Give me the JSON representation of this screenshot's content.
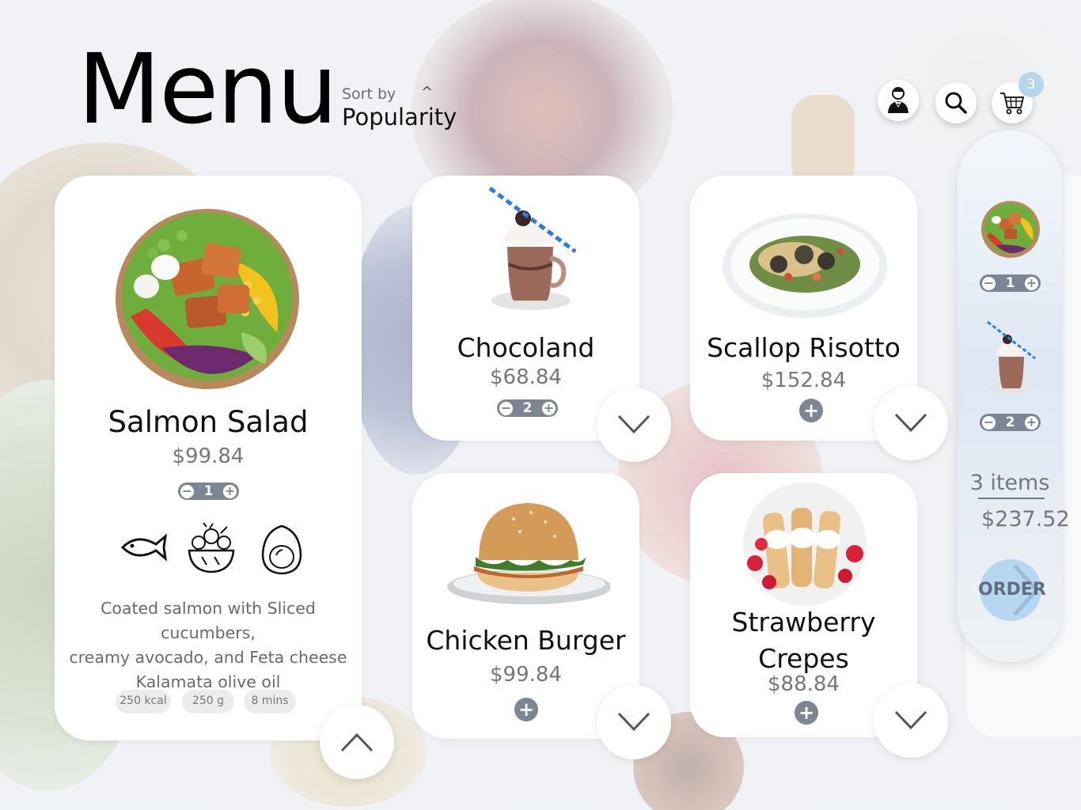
{
  "header": {
    "title": "Menu",
    "sort_label": "Sort by",
    "sort_value": "Popularity",
    "sort_caret": "^",
    "cart_count": "3"
  },
  "featured": {
    "name": "Salmon Salad",
    "price": "$99.84",
    "quantity": "1",
    "description_lines": [
      "Coated salmon with Sliced cucumbers,",
      "creamy avocado, and Feta cheese",
      "Kalamata olive oil"
    ],
    "chips": [
      "250 kcal",
      "250 g",
      "8 mins"
    ],
    "ingredient_icons": [
      "fish-icon",
      "vegetable-bowl-icon",
      "egg-icon"
    ]
  },
  "items": [
    {
      "name": "Chocoland",
      "price": "$68.84",
      "quantity": "2",
      "image": "milkshake"
    },
    {
      "name": "Scallop Risotto",
      "price": "$152.84",
      "image": "risotto-plate"
    },
    {
      "name": "Chicken Burger",
      "price": "$99.84",
      "image": "burger"
    },
    {
      "name_line1": "Strawberry",
      "name_line2": "Crepes",
      "price": "$88.84",
      "image": "crepes"
    }
  ],
  "order_panel": {
    "lines": [
      {
        "image": "salad-bowl",
        "quantity": "1"
      },
      {
        "image": "milkshake",
        "quantity": "2"
      }
    ],
    "items_count": "3 items",
    "total": "$237.52",
    "order_label": "ORDER"
  },
  "colors": {
    "stepper": "#7c8594",
    "accent": "#b6d7f2",
    "card": "#ffffff"
  }
}
